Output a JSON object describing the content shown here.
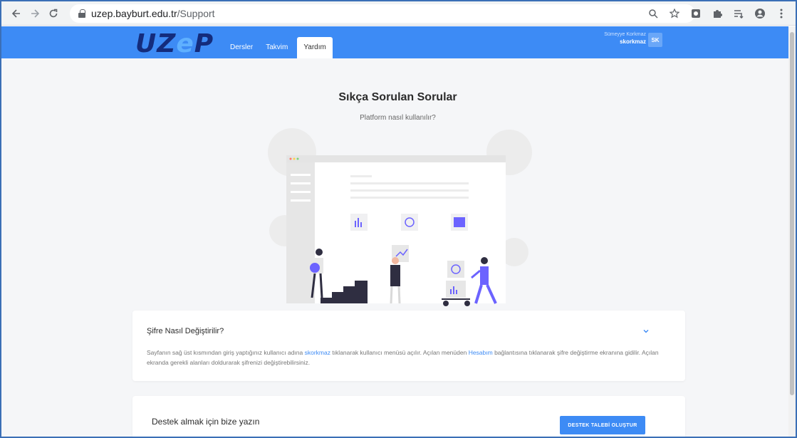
{
  "browser": {
    "url_host": "uzep.bayburt.edu.tr",
    "url_path": "/Support",
    "icons": [
      "back-arrow-icon",
      "forward-arrow-icon",
      "reload-icon",
      "lock-icon",
      "zoom-icon",
      "star-icon",
      "extension-icon",
      "puzzle-icon",
      "reading-list-icon",
      "profile-icon",
      "menu-icon"
    ]
  },
  "header": {
    "logo": {
      "u": "UZ",
      "e": "e",
      "p": "P"
    },
    "nav": [
      {
        "label": "Dersler",
        "active": false
      },
      {
        "label": "Takvim",
        "active": false
      },
      {
        "label": "Yardım",
        "active": true
      }
    ],
    "user_fullname": "Sümeyye Korkmaz",
    "user_login": "skorkmaz",
    "avatar_initials": "SK",
    "accent_color": "#3d8bf5"
  },
  "page": {
    "title": "Sıkça Sorulan Sorular",
    "subtitle": "Platform nasıl kullanılır?"
  },
  "faq": {
    "question": "Şifre Nasıl Değiştirilir?",
    "answer_part1": "Sayfanın sağ üst kısmından giriş yaptığınız kullanıcı adına ",
    "answer_link1": "skorkmaz",
    "answer_part2": " tıklanarak kullanıcı menüsü açılır. Açılan menüden ",
    "answer_link2": "Hesabım",
    "answer_part3": " bağlantısına tıklanarak şifre değiştirme ekranına gidilir. Açılan ekranda gerekli alanları doldurarak şifrenizi değiştirebilirsiniz."
  },
  "support": {
    "title": "Destek almak için bize yazın",
    "button_label": "DESTEK TALEBİ OLUŞTUR"
  }
}
